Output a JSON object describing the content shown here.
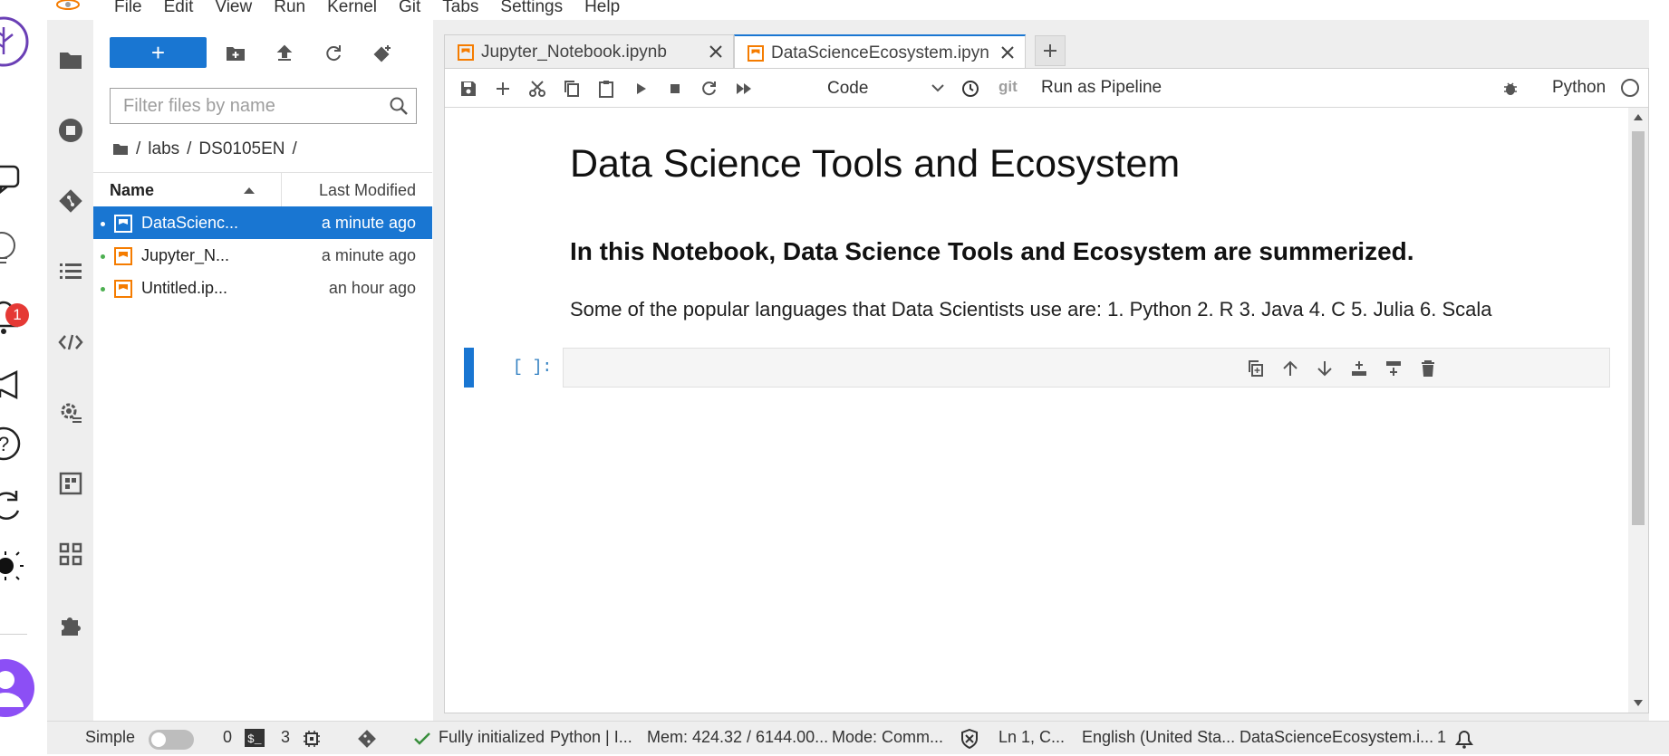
{
  "menubar": {
    "items": [
      "File",
      "Edit",
      "View",
      "Run",
      "Kernel",
      "Git",
      "Tabs",
      "Settings",
      "Help"
    ]
  },
  "outer_strip": {
    "notification_count": "1"
  },
  "file_browser": {
    "new_label": "+",
    "filter_placeholder": "Filter files by name",
    "breadcrumb": [
      "/",
      "labs",
      "/",
      "DS0105EN",
      "/"
    ],
    "columns": {
      "name": "Name",
      "last_modified": "Last Modified"
    },
    "files": [
      {
        "name": "DataScienc...",
        "modified": "a minute ago",
        "selected": true
      },
      {
        "name": "Jupyter_N...",
        "modified": "a minute ago",
        "selected": false
      },
      {
        "name": "Untitled.ip...",
        "modified": "an hour ago",
        "selected": false
      }
    ]
  },
  "tabs": [
    {
      "label": "Jupyter_Notebook.ipynb",
      "active": false
    },
    {
      "label": "DataScienceEcosystem.ipyn",
      "active": true
    }
  ],
  "toolbar": {
    "cell_type": "Code",
    "git": "git",
    "run_pipeline": "Run as Pipeline",
    "kernel": "Python"
  },
  "notebook": {
    "heading1": "Data Science Tools and Ecosystem",
    "heading3": "In this Notebook, Data Science Tools and Ecosystem are summerized.",
    "paragraph": "Some of the popular languages that Data Scientists use are: 1. Python 2. R 3. Java 4. C 5. Julia 6. Scala",
    "prompt": "[ ]:"
  },
  "status_bar": {
    "simple": "Simple",
    "terminals": "0",
    "kernels": "3",
    "init": "Fully initialized",
    "kernel": "Python | I...",
    "mem": "Mem: 424.32 / 6144.00...",
    "mode": "Mode: Comm...",
    "position": "Ln 1, C...",
    "language": "English (United Sta...",
    "file": "DataScienceEcosystem.i...",
    "notifications": "1"
  },
  "colors": {
    "accent": "#1976d2",
    "notebook_icon": "#f57c00",
    "dot": "#4caf50",
    "prompt": "#307fc1"
  }
}
